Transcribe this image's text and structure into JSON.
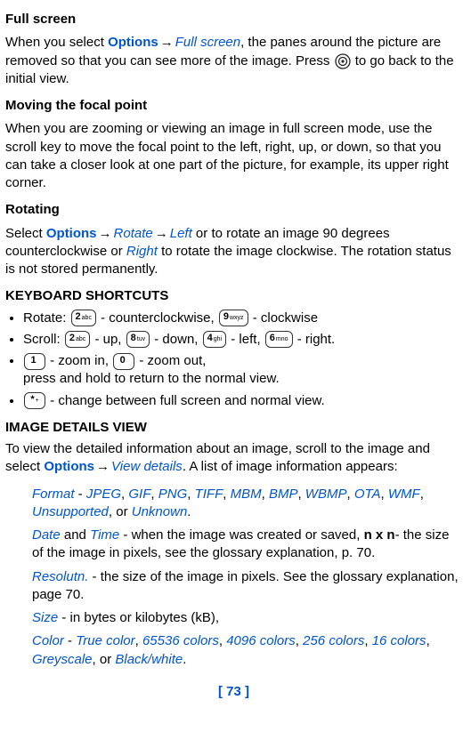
{
  "sec1": {
    "title": "Full screen",
    "p1a": "When you select ",
    "opt": "Options",
    "arrow": "→ ",
    "full": "Full screen",
    "p1b": ", the panes around the picture are removed so that you can see more of the image. Press ",
    "p1c": " to go back to the initial view."
  },
  "sec2": {
    "title": "Moving the focal point",
    "p": "When you are zooming or viewing an image in full screen mode, use the scroll key to move the focal point to the left, right, up, or down, so that you can take a closer look at one part of the picture, for example, its upper right corner."
  },
  "sec3": {
    "title": "Rotating",
    "p1a": "Select ",
    "opt": "Options",
    "arrow": "→ ",
    "rotate": "Rotate",
    "left": "Left",
    "p1b": " or to rotate an image 90 degrees counterclockwise or ",
    "right": "Right",
    "p1c": " to rotate the image clockwise. The rotation status is not stored permanently."
  },
  "kb": {
    "title": "KEYBOARD SHORTCUTS",
    "b1a": "Rotate: ",
    "b1b": " - counterclockwise, ",
    "b1c": " - clockwise",
    "b2a": "Scroll: ",
    "b2b": " - up, ",
    "b2c": " - down,  ",
    "b2d": " - left, ",
    "b2e": " - right.",
    "b3a": " - zoom in,  ",
    "b3b": " - zoom out,",
    "b3c": "press and hold to return to the normal view.",
    "b4": " - change between full screen and normal view."
  },
  "details": {
    "title": "IMAGE DETAILS VIEW",
    "p1a": "To view the detailed information about an image, scroll to the image and select ",
    "opt": "Options",
    "arrow": "→ ",
    "view": "View details",
    "p1b": ". A list of image information appears:",
    "fmt_label": "Format",
    "fmt_sep": " - ",
    "fmt_list": [
      "JPEG",
      "GIF",
      "PNG",
      "TIFF",
      "MBM",
      "BMP",
      "WBMP",
      "OTA",
      "WMF",
      "Unsupported",
      "Unknown"
    ],
    "fmt_or": ", or ",
    "date": "Date",
    "and": " and ",
    "time": "Time",
    "dt_a": " - when the image was created or saved, ",
    "nxn": "n x n",
    "dt_b": "- the size of the image in pixels, see the glossary explanation, p. 70.",
    "res_label": "Resolutn.",
    "res_text": " - the size of the image in pixels.  See the glossary explanation, page 70.",
    "size_label": "Size",
    "size_text": " - in bytes or kilobytes (kB),",
    "color_label": "Color",
    "color_sep": " - ",
    "color_list": [
      "True color",
      "65536 colors",
      "4096 colors",
      "256 colors",
      "16 colors",
      "Greyscale",
      "Black/white"
    ],
    "color_or": ", or "
  },
  "footer": "[ 73 ]"
}
